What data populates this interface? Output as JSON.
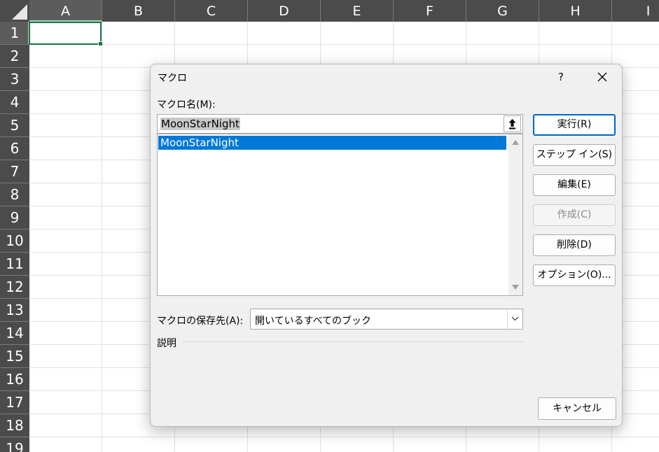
{
  "sheet": {
    "columns": [
      "A",
      "B",
      "C",
      "D",
      "E",
      "F",
      "G",
      "H",
      "I"
    ],
    "rows": [
      "1",
      "2",
      "3",
      "4",
      "5",
      "6",
      "7",
      "8",
      "9",
      "10",
      "11",
      "12",
      "13",
      "14",
      "15",
      "16",
      "17",
      "18",
      "19"
    ],
    "selected_column": "A",
    "selected_row": "1"
  },
  "dialog": {
    "title": "マクロ",
    "help": "?",
    "macro_name_label": "マクロ名(M):",
    "macro_name_value": "MoonStarNight",
    "macros": [
      "MoonStarNight"
    ],
    "buttons": {
      "run": "実行(R)",
      "step_in": "ステップ イン(S)",
      "edit": "編集(E)",
      "create": "作成(C)",
      "delete": "削除(D)",
      "options": "オプション(O)...",
      "cancel": "キャンセル"
    },
    "store_label": "マクロの保存先(A):",
    "store_value": "開いているすべてのブック",
    "description_label": "説明"
  },
  "colors": {
    "header_bg": "#4b4b4b",
    "selection_blue": "#0078d7",
    "active_cell_green": "#1e7145"
  }
}
